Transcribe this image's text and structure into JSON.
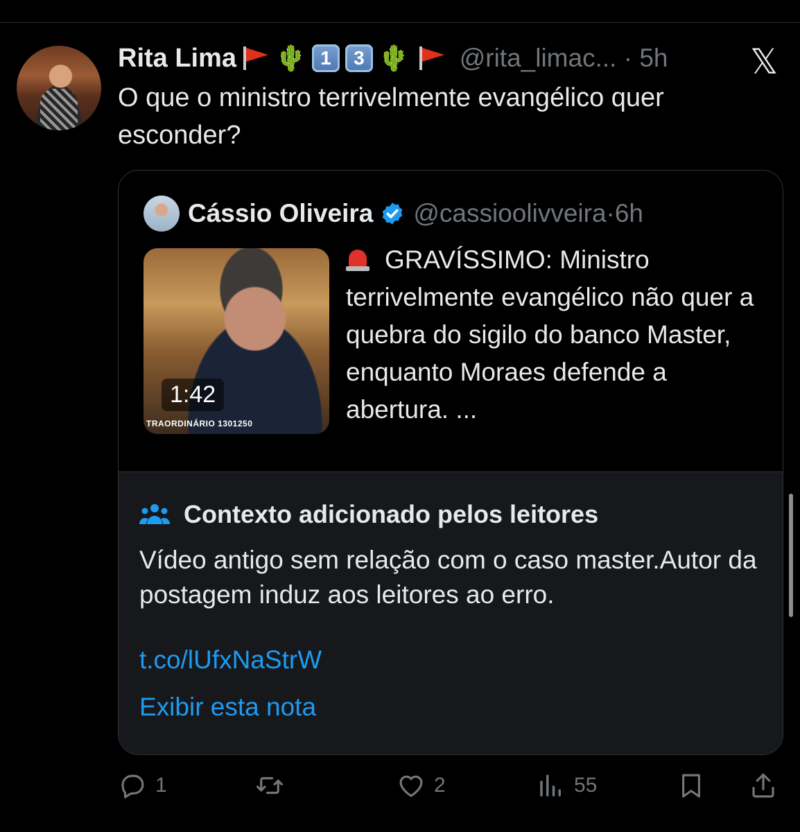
{
  "post": {
    "author_name": "Rita Lima",
    "author_handle": "@rita_limac...",
    "time_sep": "·",
    "time": "5h",
    "keycaps": [
      "1",
      "3"
    ],
    "text": "O que o ministro terrivelmente evangélico quer esconder?"
  },
  "quoted_post": {
    "author_name": "Cássio Oliveira",
    "author_handle": "@cassioolivveira",
    "time_sep": "·",
    "time": "6h",
    "video_duration": "1:42",
    "video_caption": "TRAORDINÁRIO 1301250",
    "text": "GRAVÍSSIMO: Ministro terrivelmente evangélico não quer a quebra do sigilo do banco Master, enquanto Moraes defende a abertura. ..."
  },
  "community_note": {
    "title": "Contexto adicionado pelos leitores",
    "text": "Vídeo antigo sem relação com o caso master.Autor da postagem induz aos leitores ao erro.",
    "link": "t.co/lUfxNaStrW",
    "show_label": "Exibir esta nota"
  },
  "actions": {
    "replies": "1",
    "likes": "2",
    "views": "55"
  },
  "icons": [
    "x-logo-icon",
    "flag-icon",
    "cactus-icon",
    "keycap-icon",
    "verified-badge-icon",
    "siren-icon",
    "people-icon",
    "reply-icon",
    "repost-icon",
    "like-icon",
    "views-icon",
    "bookmark-icon",
    "share-icon"
  ],
  "colors": {
    "background": "#000000",
    "text": "#e7e9ea",
    "muted": "#71767b",
    "link": "#1d9bf0",
    "note_background": "#16181c",
    "verified": "#1d9bf0"
  }
}
